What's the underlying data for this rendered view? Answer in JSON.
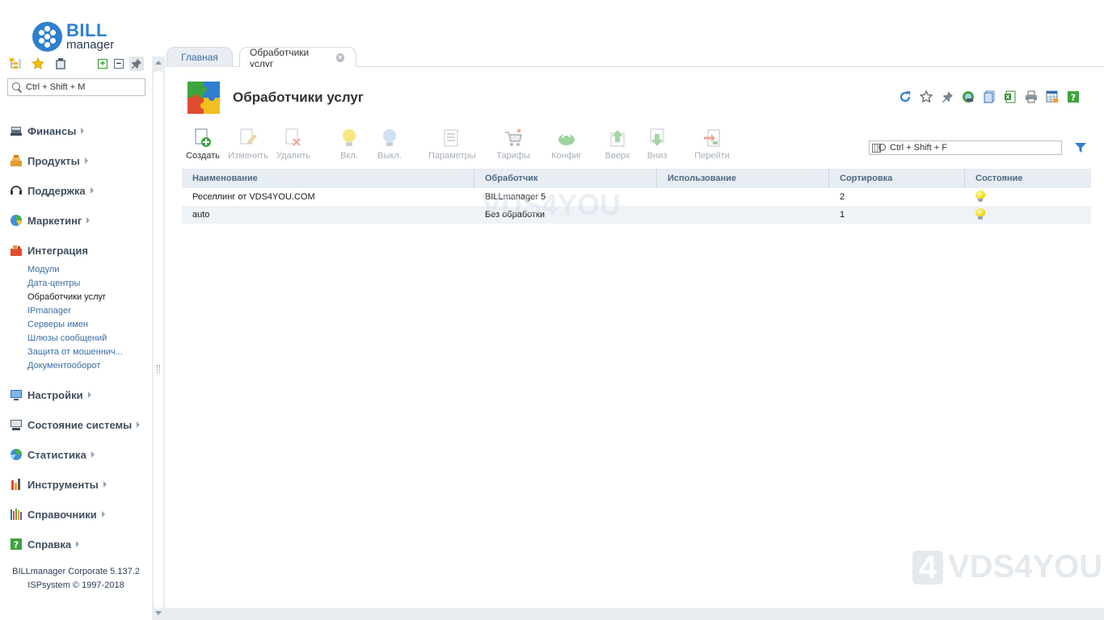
{
  "app": {
    "logo_bill": "BILL",
    "logo_manager": "manager",
    "version": "BILLmanager Corporate 5.137.2",
    "copyright": "ISPsystem © 1997-2018"
  },
  "sidebar": {
    "search_placeholder": "Ctrl + Shift + M",
    "groups": [
      {
        "label": "Финансы"
      },
      {
        "label": "Продукты"
      },
      {
        "label": "Поддержка"
      },
      {
        "label": "Маркетинг"
      },
      {
        "label": "Интеграция"
      },
      {
        "label": "Настройки"
      },
      {
        "label": "Состояние системы"
      },
      {
        "label": "Статистика"
      },
      {
        "label": "Инструменты"
      },
      {
        "label": "Справочники"
      },
      {
        "label": "Справка"
      }
    ],
    "integration_items": [
      {
        "label": "Модули"
      },
      {
        "label": "Дата-центры"
      },
      {
        "label": "Обработчики услуг",
        "active": true
      },
      {
        "label": "IPmanager"
      },
      {
        "label": "Серверы имен"
      },
      {
        "label": "Шлюзы сообщений"
      },
      {
        "label": "Защита от мошеннич..."
      },
      {
        "label": "Документооборот"
      }
    ]
  },
  "tabs": [
    {
      "label": "Главная",
      "active": false
    },
    {
      "label": "Обработчики услуг",
      "active": true
    }
  ],
  "page": {
    "title": "Обработчики услуг",
    "filter_placeholder": "Ctrl + Shift + F"
  },
  "toolbar": [
    {
      "label": "Создать",
      "enabled": true
    },
    {
      "label": "Изменить",
      "enabled": false
    },
    {
      "label": "Удалить",
      "enabled": false
    },
    {
      "label": "Вкл.",
      "enabled": false
    },
    {
      "label": "Выкл.",
      "enabled": false
    },
    {
      "label": "Параметры",
      "enabled": false
    },
    {
      "label": "Тарифы",
      "enabled": false
    },
    {
      "label": "Конфиг",
      "enabled": false
    },
    {
      "label": "Вверх",
      "enabled": false
    },
    {
      "label": "Вниз",
      "enabled": false
    },
    {
      "label": "Перейти",
      "enabled": false
    }
  ],
  "table": {
    "columns": [
      "Наименование",
      "Обработчик",
      "Использование",
      "Сортировка",
      "Состояние"
    ],
    "rows": [
      {
        "name": "Реселлинг от VDS4YOU.COM",
        "handler": "BILLmanager 5",
        "usage": "",
        "sort": "2",
        "state": "on"
      },
      {
        "name": "auto",
        "handler": "Без обработки",
        "usage": "",
        "sort": "1",
        "state": "on"
      }
    ]
  },
  "watermark": {
    "text": "VDS4YOU",
    "digit": "4"
  },
  "colors": {
    "accent": "#2e7fd0",
    "link": "#3a6da3",
    "header_bg": "#e7edf2",
    "zebra": "#eef3f7"
  }
}
